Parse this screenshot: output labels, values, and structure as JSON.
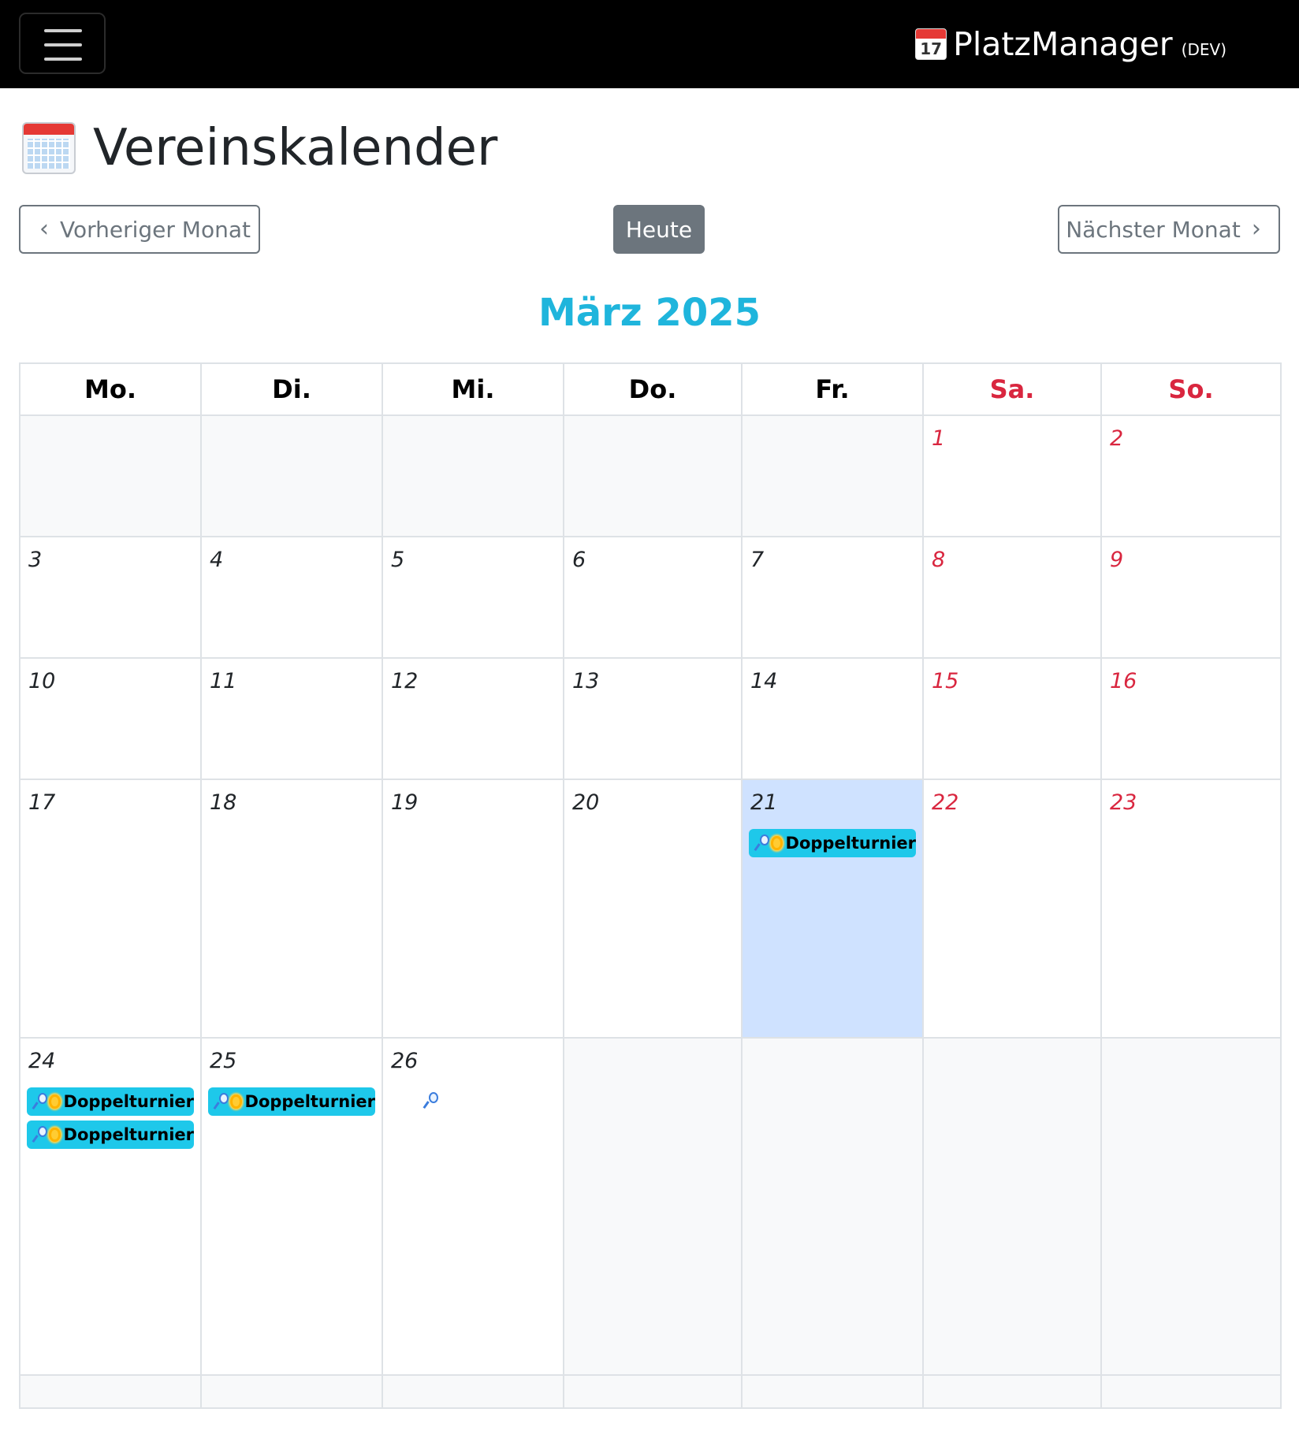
{
  "navbar": {
    "brand_icon_day": "17",
    "brand_name": "PlatzManager",
    "brand_env": "(DEV)"
  },
  "header": {
    "title": "Vereinskalender",
    "title_icon": "calendar-icon"
  },
  "nav_buttons": {
    "prev_label": "Vorheriger Monat",
    "today_label": "Heute",
    "next_label": "Nächster Monat"
  },
  "calendar": {
    "month_label": "März 2025",
    "weekdays": [
      "Mo.",
      "Di.",
      "Mi.",
      "Do.",
      "Fr.",
      "Sa.",
      "So."
    ],
    "days": {
      "d1": "1",
      "d2": "2",
      "d3": "3",
      "d4": "4",
      "d5": "5",
      "d6": "6",
      "d7": "7",
      "d8": "8",
      "d9": "9",
      "d10": "10",
      "d11": "11",
      "d12": "12",
      "d13": "13",
      "d14": "14",
      "d15": "15",
      "d16": "16",
      "d17": "17",
      "d18": "18",
      "d19": "19",
      "d20": "20",
      "d21": "21",
      "d22": "22",
      "d23": "23",
      "d24": "24",
      "d25": "25",
      "d26": "26"
    },
    "today": "21",
    "events": {
      "e21_1": "Doppelturnier",
      "e24_1": "Doppelturnier",
      "e24_2": "Doppelturnier",
      "e25_1": "Doppelturnier"
    },
    "event_icons": [
      "tennis-racket-icon",
      "sun-icon"
    ],
    "colors": {
      "event_bg": "#1ec8ea",
      "today_bg": "#cfe2ff",
      "weekend_text": "#d9263f",
      "month_title": "#1fb5dc"
    }
  }
}
